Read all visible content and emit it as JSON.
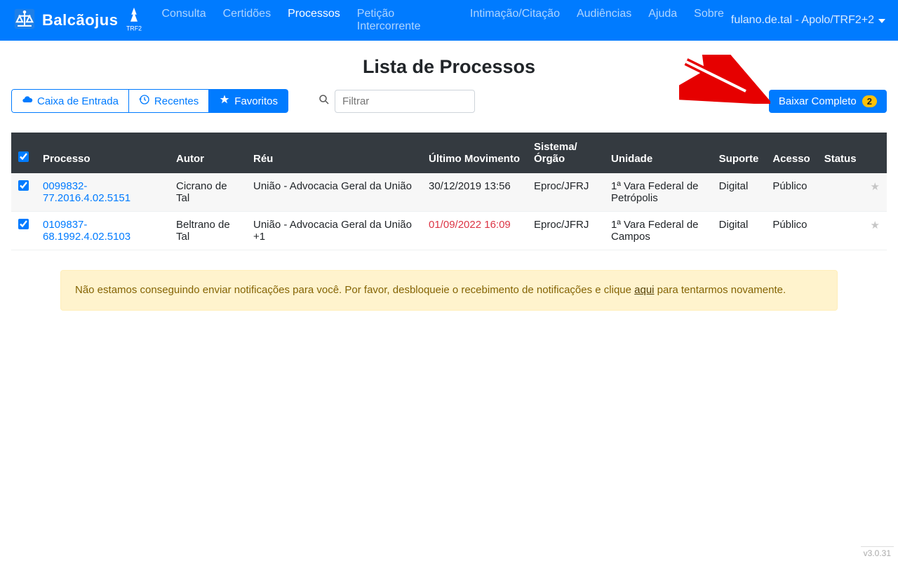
{
  "brand": {
    "name": "Balcãojus",
    "sub": "TRF2"
  },
  "nav": {
    "items": [
      {
        "label": "Consulta"
      },
      {
        "label": "Certidões"
      },
      {
        "label": "Processos",
        "active": true
      },
      {
        "label": "Petição Intercorrente"
      },
      {
        "label": "Intimação/Citação"
      },
      {
        "label": "Audiências"
      },
      {
        "label": "Ajuda"
      },
      {
        "label": "Sobre"
      }
    ],
    "user": "fulano.de.tal - Apolo/TRF2+2"
  },
  "page": {
    "title": "Lista de Processos"
  },
  "tabs": {
    "inbox": "Caixa de Entrada",
    "recents": "Recentes",
    "favorites": "Favoritos"
  },
  "filter": {
    "placeholder": "Filtrar"
  },
  "download": {
    "label": "Baixar Completo",
    "count": "2"
  },
  "table": {
    "headers": {
      "processo": "Processo",
      "autor": "Autor",
      "reu": "Réu",
      "ultimo": "Último Movimento",
      "sistema": "Sistema/ Órgão",
      "unidade": "Unidade",
      "suporte": "Suporte",
      "acesso": "Acesso",
      "status": "Status"
    },
    "rows": [
      {
        "processo": "0099832-77.2016.4.02.5151",
        "autor": "Cicrano de Tal",
        "reu": "União - Advocacia Geral da União",
        "ultimo": "30/12/2019 13:56",
        "ultimo_red": false,
        "sistema": "Eproc/JFRJ",
        "unidade": "1ª Vara Federal de Petrópolis",
        "suporte": "Digital",
        "acesso": "Público"
      },
      {
        "processo": "0109837-68.1992.4.02.5103",
        "autor": "Beltrano de Tal",
        "reu": "União - Advocacia Geral da União +1",
        "ultimo": "01/09/2022 16:09",
        "ultimo_red": true,
        "sistema": "Eproc/JFRJ",
        "unidade": "1ª Vara Federal de Campos",
        "suporte": "Digital",
        "acesso": "Público"
      }
    ]
  },
  "alert": {
    "text_before": "Não estamos conseguindo enviar notificações para você. Por favor, desbloqueie o recebimento de notificações e clique ",
    "link": "aqui",
    "text_after": " para tentarmos novamente."
  },
  "footer": {
    "version": "v3.0.31"
  }
}
